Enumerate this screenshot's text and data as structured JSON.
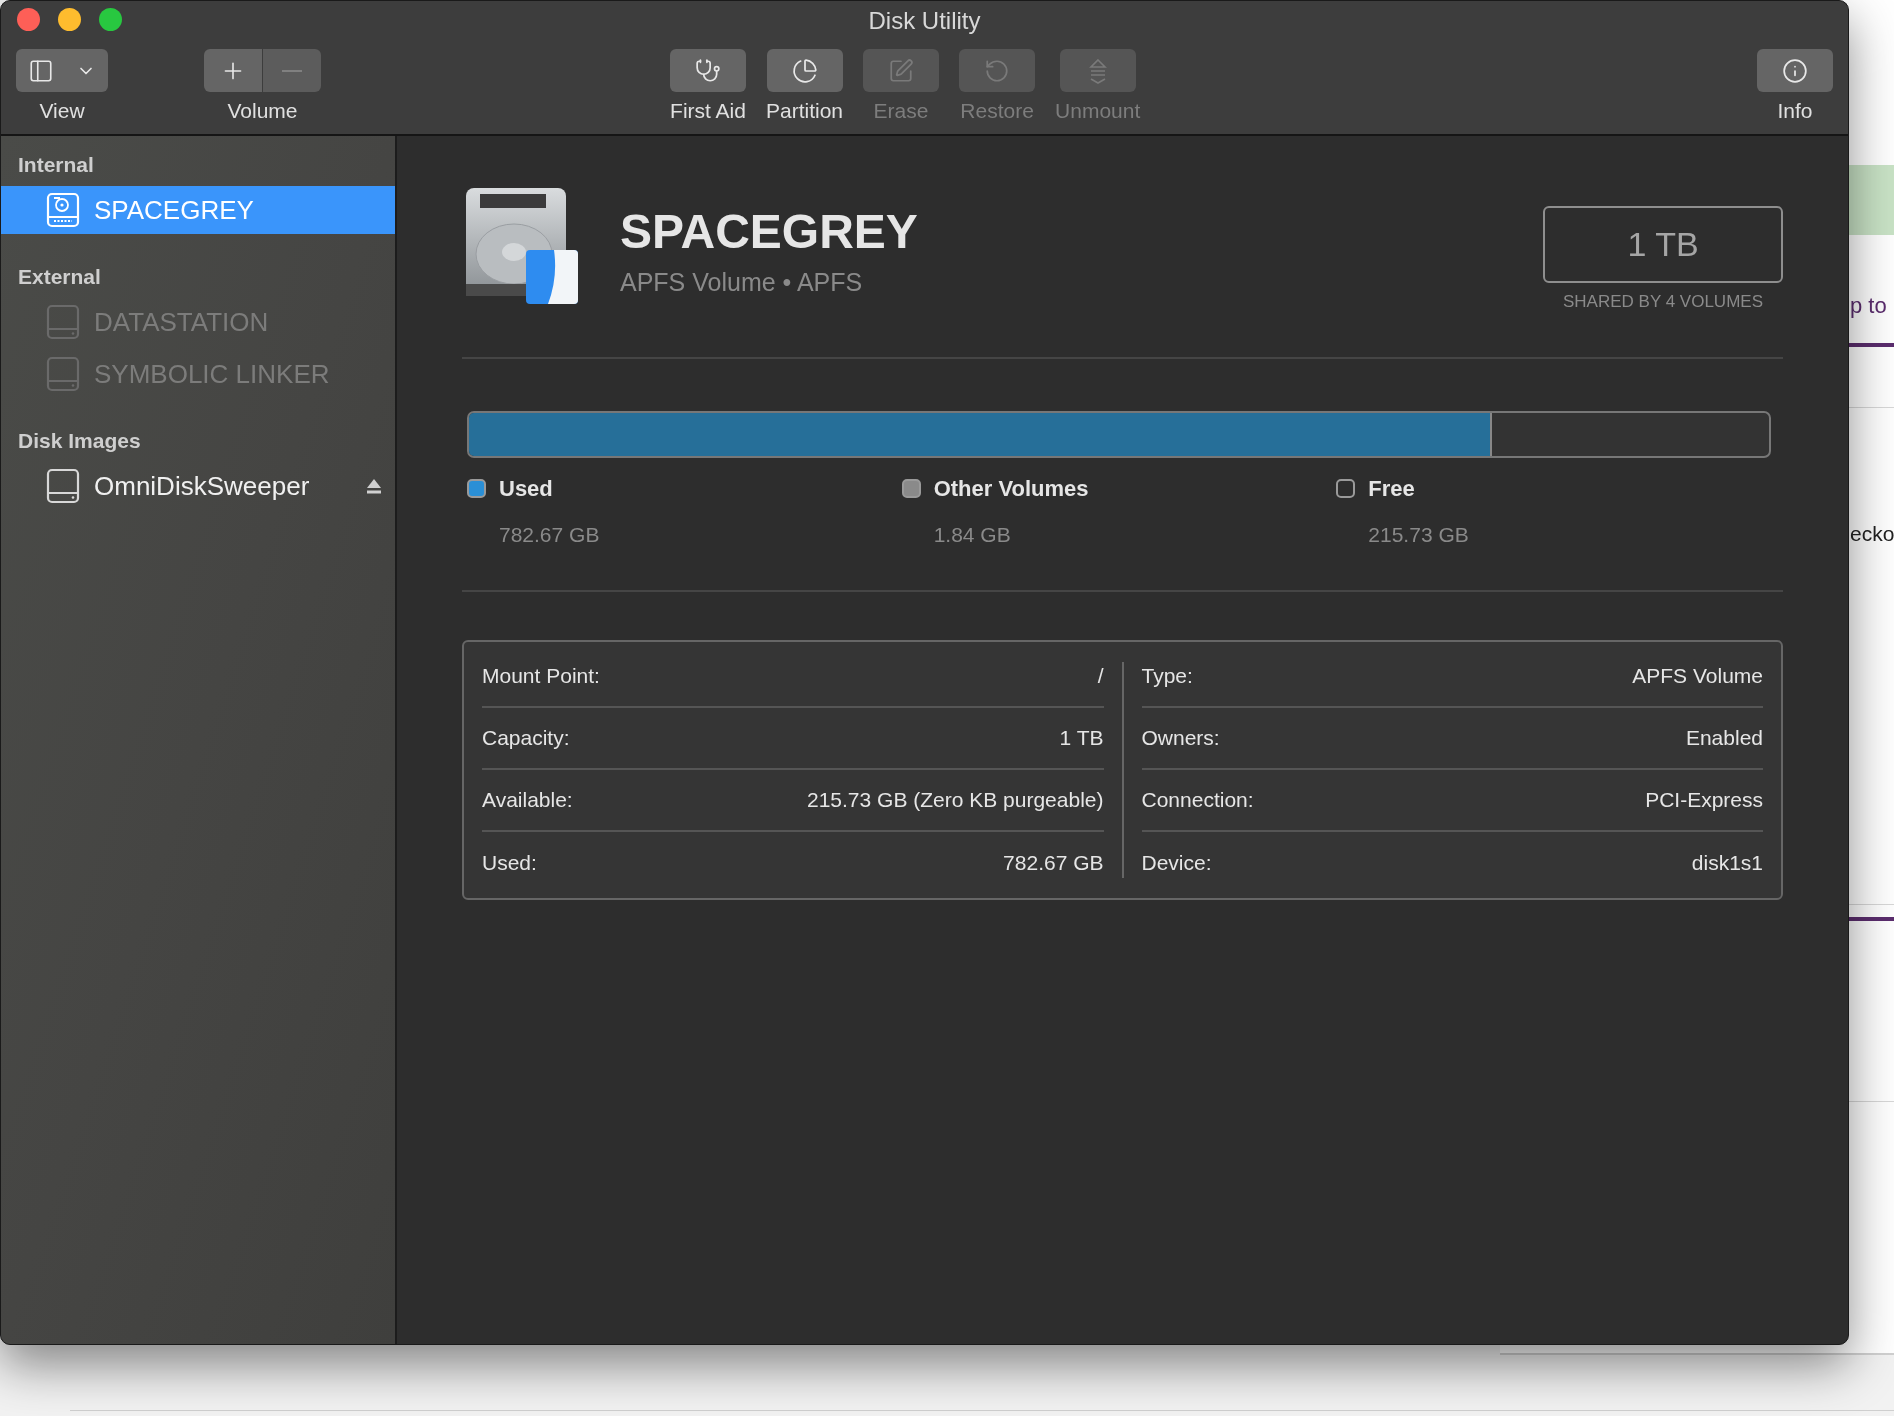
{
  "window": {
    "title": "Disk Utility"
  },
  "toolbar": {
    "left": [
      {
        "kind": "view",
        "label": "View"
      },
      {
        "kind": "volume",
        "label": "Volume",
        "add_disabled": false,
        "remove_disabled": true
      }
    ],
    "center": [
      {
        "kind": "first-aid",
        "label": "First Aid",
        "disabled": false
      },
      {
        "kind": "partition",
        "label": "Partition",
        "disabled": false
      },
      {
        "kind": "erase",
        "label": "Erase",
        "disabled": true
      },
      {
        "kind": "restore",
        "label": "Restore",
        "disabled": true
      },
      {
        "kind": "unmount",
        "label": "Unmount",
        "disabled": true
      }
    ],
    "right": [
      {
        "kind": "info",
        "label": "Info",
        "disabled": false
      }
    ]
  },
  "sidebar": {
    "sections": [
      {
        "title": "Internal",
        "items": [
          {
            "kind": "internal",
            "name": "SPACEGREY",
            "selected": true,
            "mounted": true,
            "ejectable": false
          }
        ]
      },
      {
        "title": "External",
        "items": [
          {
            "kind": "external",
            "name": "DATASTATION",
            "selected": false,
            "mounted": false,
            "ejectable": false
          },
          {
            "kind": "external",
            "name": "SYMBOLIC LINKER",
            "selected": false,
            "mounted": false,
            "ejectable": false
          }
        ]
      },
      {
        "title": "Disk Images",
        "items": [
          {
            "kind": "image",
            "name": "OmniDiskSweeper",
            "selected": false,
            "mounted": true,
            "ejectable": true
          }
        ]
      }
    ]
  },
  "volume": {
    "name": "SPACEGREY",
    "subtitle": "APFS Volume • APFS",
    "capacity": "1 TB",
    "capacity_note": "SHARED BY 4 VOLUMES"
  },
  "usage": {
    "level": 0.787,
    "legend": [
      {
        "label": "Used",
        "value": "782.67 GB",
        "color": "#2a8fd6"
      },
      {
        "label": "Other Volumes",
        "value": "1.84 GB",
        "color": "#8a8a8a"
      },
      {
        "label": "Free",
        "value": "215.73 GB",
        "color": "#2d2d2d"
      }
    ]
  },
  "details": {
    "left": [
      {
        "label": "Mount Point:",
        "value": "/"
      },
      {
        "label": "Capacity:",
        "value": "1 TB"
      },
      {
        "label": "Available:",
        "value": "215.73 GB (Zero KB purgeable)"
      },
      {
        "label": "Used:",
        "value": "782.67 GB"
      }
    ],
    "right": [
      {
        "label": "Type:",
        "value": "APFS Volume"
      },
      {
        "label": "Owners:",
        "value": "Enabled"
      },
      {
        "label": "Connection:",
        "value": "PCI-Express"
      },
      {
        "label": "Device:",
        "value": "disk1s1"
      }
    ]
  },
  "background_window": {
    "texts": [
      "p to",
      "ecko"
    ]
  }
}
